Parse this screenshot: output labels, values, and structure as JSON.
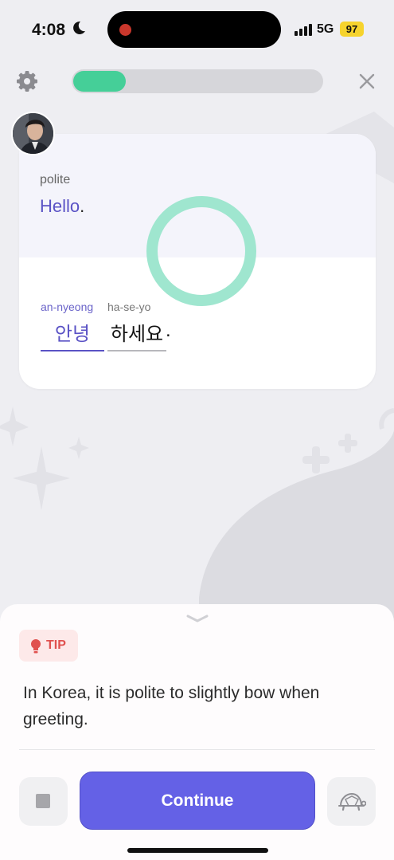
{
  "status": {
    "time": "4:08",
    "network": "5G",
    "battery": "97",
    "icons": [
      "moon-icon",
      "signal-icon",
      "screen-recording-icon"
    ]
  },
  "header": {
    "progress_fraction": 0.21,
    "progress_color": "#45cf98",
    "icons": [
      "gear-icon",
      "close-icon"
    ]
  },
  "lesson": {
    "register": "polite",
    "english_word": "Hello",
    "english_punct": ".",
    "words": [
      {
        "romanization": "an-nyeong",
        "hangul": "안녕"
      },
      {
        "romanization": "ha-se-yo",
        "hangul": "하세요"
      }
    ],
    "korean_punct": ".",
    "accent_color": "#5a52c5"
  },
  "sheet": {
    "tip_label": "TIP",
    "tip_text": "In Korea, it is polite to slightly bow when greeting.",
    "continue_label": "Continue",
    "icons": [
      "chevron-down-icon",
      "lightbulb-icon",
      "stop-icon",
      "turtle-icon"
    ]
  }
}
